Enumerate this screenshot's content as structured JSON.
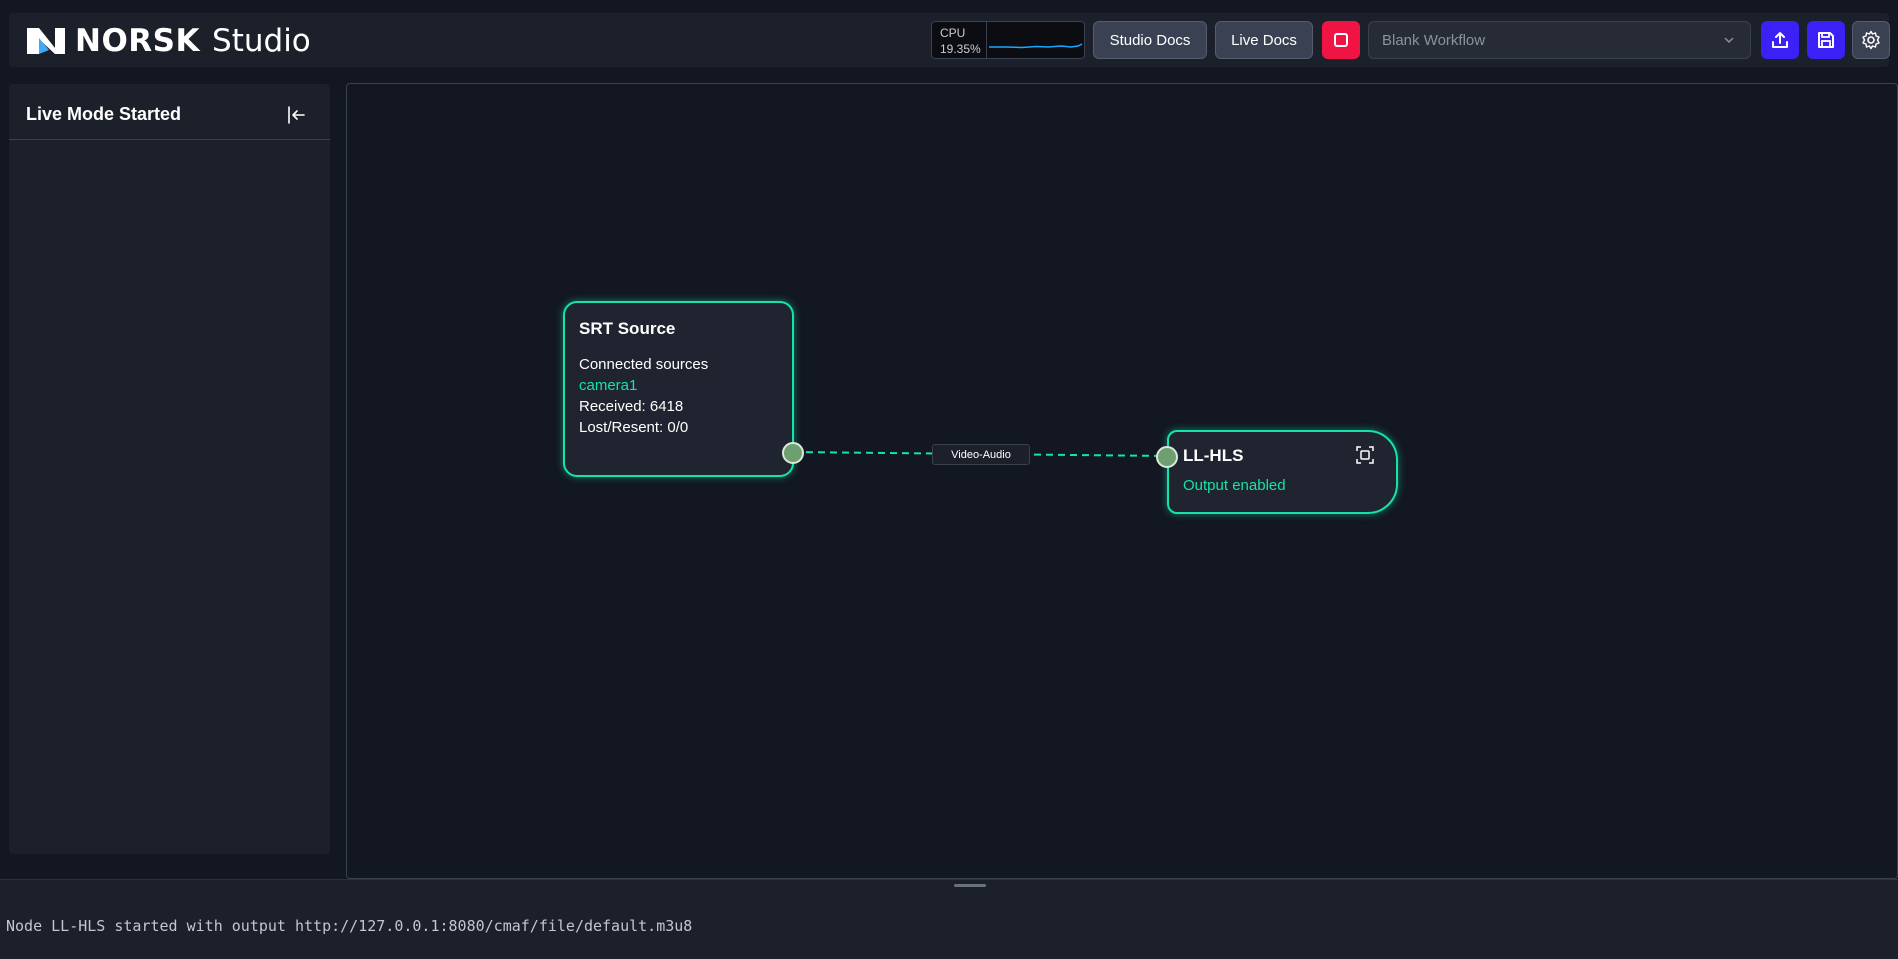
{
  "header": {
    "brand_bold": "NORSK",
    "brand_light": "Studio",
    "cpu": {
      "label": "CPU",
      "value": "19.35%"
    },
    "studio_docs_label": "Studio Docs",
    "live_docs_label": "Live Docs",
    "workflow_select": {
      "value": "Blank Workflow"
    },
    "icons": [
      "upload-icon",
      "save-icon",
      "gear-icon",
      "stop-icon"
    ],
    "accent_colors": {
      "stop": "#f01445",
      "primary": "#3b21f5"
    }
  },
  "sidebar": {
    "title": "Live Mode Started"
  },
  "canvas": {
    "nodes": [
      {
        "id": "srt",
        "title": "SRT Source",
        "lines": [
          "Connected sources",
          "camera1",
          "Received: 6418",
          "Lost/Resent: 0/0"
        ]
      },
      {
        "id": "hls",
        "title": "LL-HLS",
        "lines": [
          "Output enabled"
        ]
      }
    ],
    "edge": {
      "label": "Video-Audio",
      "color": "#15e3a8"
    }
  },
  "log": {
    "message": "Node LL-HLS started with output http://127.0.0.1:8080/cmaf/file/default.m3u8"
  }
}
